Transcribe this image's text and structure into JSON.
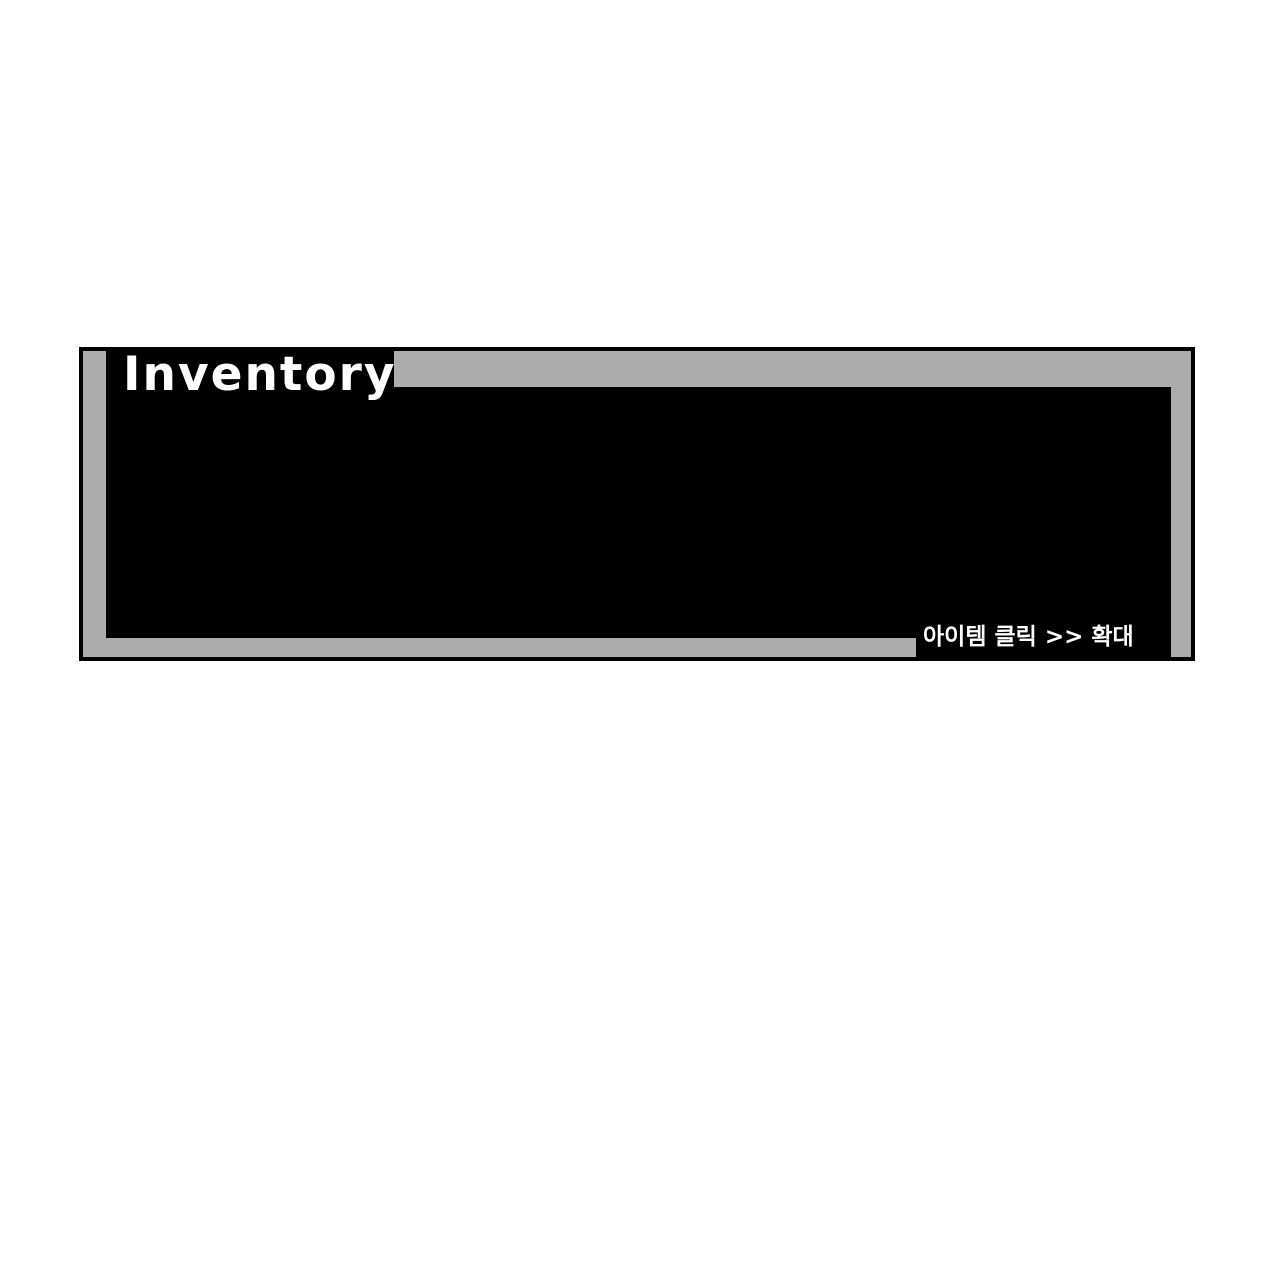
{
  "inventory": {
    "title": "Inventory",
    "hint": "아이템 클릭 >> 확대"
  },
  "colors": {
    "background": "#ffffff",
    "frame": "#000000",
    "border": "#acacac",
    "text": "#ffffff"
  }
}
